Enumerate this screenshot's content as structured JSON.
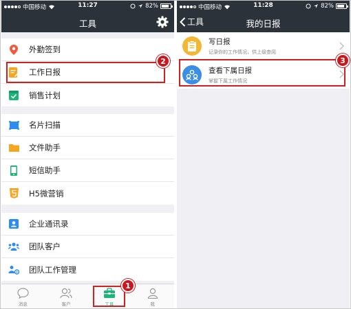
{
  "status_bar": {
    "carrier": "中国移动",
    "battery": "82%",
    "time_left": "11:27",
    "time_right": "11:28"
  },
  "left_screen": {
    "title": "工具",
    "menu_groups": [
      [
        {
          "label": "外勤签到",
          "icon": "location-pin-icon",
          "color": "#f05a3c"
        },
        {
          "label": "工作日报",
          "icon": "daily-report-icon",
          "color": "#f5a623"
        },
        {
          "label": "销售计划",
          "icon": "sales-plan-icon",
          "color": "#1fb47a"
        }
      ],
      [
        {
          "label": "名片扫描",
          "icon": "card-scan-icon",
          "color": "#2d8cf0"
        },
        {
          "label": "文件助手",
          "icon": "folder-icon",
          "color": "#f5a623"
        },
        {
          "label": "短信助手",
          "icon": "phone-sms-icon",
          "color": "#1fb47a"
        },
        {
          "label": "H5微营销",
          "icon": "html5-icon",
          "color": "#f5a623"
        }
      ],
      [
        {
          "label": "企业通讯录",
          "icon": "contacts-icon",
          "color": "#2d8cf0"
        },
        {
          "label": "团队客户",
          "icon": "team-customers-icon",
          "color": "#2d8cf0"
        },
        {
          "label": "团队工作管理",
          "icon": "team-work-icon",
          "color": "#2d8cf0"
        }
      ]
    ],
    "tabs": [
      {
        "label": "消息",
        "icon": "message-icon"
      },
      {
        "label": "客户",
        "icon": "customers-icon"
      },
      {
        "label": "工具",
        "icon": "toolbox-icon",
        "active": true
      },
      {
        "label": "我",
        "icon": "person-icon"
      }
    ]
  },
  "right_screen": {
    "back_label": "工具",
    "title": "我的日报",
    "items": [
      {
        "title": "写日报",
        "subtitle": "记录你的工作情况，供上级查阅",
        "icon": "write-report-icon",
        "color": "#f5b731"
      },
      {
        "title": "查看下属日报",
        "subtitle": "掌握下属工作情况",
        "icon": "team-report-icon",
        "color": "#3a8ee6"
      }
    ]
  },
  "annotations": {
    "badge_1": "1",
    "badge_2": "2",
    "badge_3": "3",
    "highlight_color": "#d21e1e"
  }
}
